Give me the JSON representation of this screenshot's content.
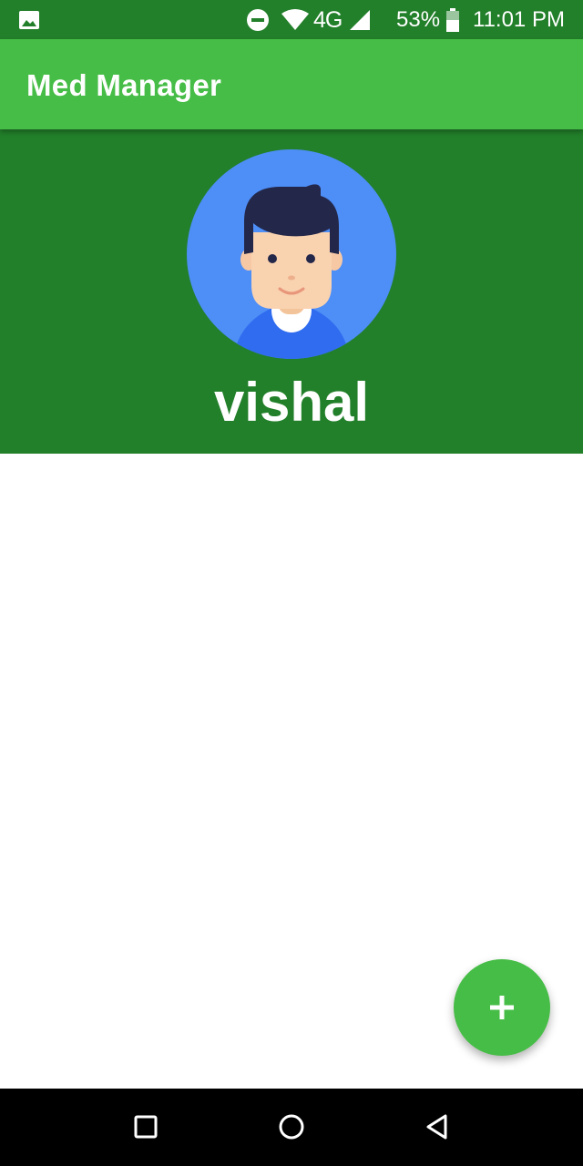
{
  "status_bar": {
    "network": "4G",
    "battery": "53%",
    "time": "11:01 PM",
    "icons": [
      "gallery-icon",
      "dnd-icon",
      "wifi-icon",
      "signal-icon",
      "battery-icon"
    ]
  },
  "app_bar": {
    "title": "Med Manager"
  },
  "profile": {
    "name": "vishal",
    "avatar_icon": "avatar-boy-icon"
  },
  "fab": {
    "icon": "plus-icon"
  },
  "nav_bar": {
    "buttons": [
      "recents-icon",
      "home-icon",
      "back-icon"
    ]
  },
  "colors": {
    "status_bar": "#227f2a",
    "app_bar": "#46bd46",
    "header": "#227f2a",
    "fab": "#46bd46",
    "avatar_bg": "#4d8ef7"
  }
}
